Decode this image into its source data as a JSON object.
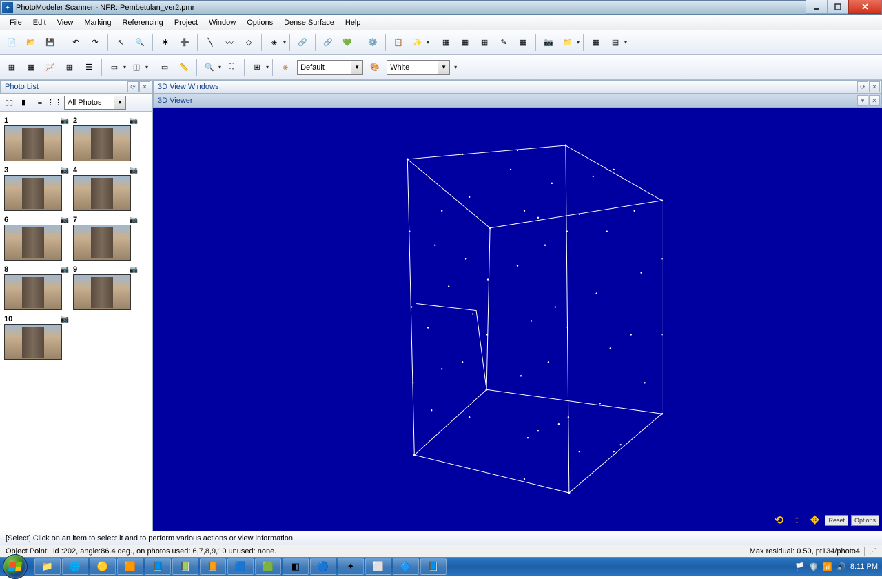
{
  "title": "PhotoModeler Scanner - NFR: Pembetulan_ver2.pmr",
  "menus": [
    "File",
    "Edit",
    "View",
    "Marking",
    "Referencing",
    "Project",
    "Window",
    "Options",
    "Dense Surface",
    "Help"
  ],
  "toolbar2": {
    "layer": "Default",
    "color": "White"
  },
  "panels": {
    "photo_list": "Photo List",
    "view_windows": "3D View Windows",
    "viewer_tab": "3D Viewer"
  },
  "photo_filter": "All Photos",
  "thumbs": [
    "1",
    "2",
    "3",
    "4",
    "6",
    "7",
    "8",
    "9",
    "10"
  ],
  "view_btns": {
    "reset": "Reset",
    "options": "Options"
  },
  "status_hint": "[Select] Click on an item to select it and to perform various actions or view information.",
  "status_obj": "Object Point::  id :202,  angle:86.4 deg.,  on photos used: 6,7,8,9,10   unused: none.",
  "status_resid": "Max residual: 0.50, pt134/photo4",
  "clock": {
    "time": "8:11 PM"
  }
}
